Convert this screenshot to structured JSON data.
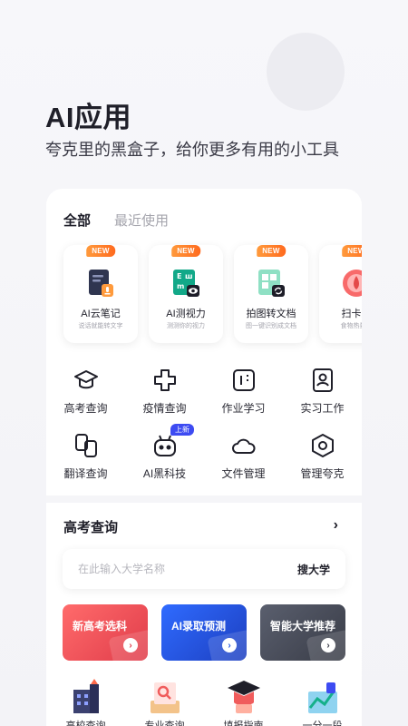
{
  "header": {
    "title": "AI应用",
    "subtitle": "夸克里的黑盒子，给你更多有用的小工具"
  },
  "tabs": [
    {
      "label": "全部",
      "active": true
    },
    {
      "label": "最近使用",
      "active": false
    }
  ],
  "featured": [
    {
      "badge": "NEW",
      "name": "AI云笔记",
      "desc": "说话就能转文字",
      "icon": "note-icon"
    },
    {
      "badge": "NEW",
      "name": "AI测视力",
      "desc": "测测你的视力",
      "icon": "eye-chart-icon"
    },
    {
      "badge": "NEW",
      "name": "拍图转文档",
      "desc": "图一键识别成文档",
      "icon": "scan-doc-icon"
    },
    {
      "badge": "NEW",
      "name": "扫卡路",
      "desc": "食物热量一",
      "icon": "calorie-icon"
    }
  ],
  "grid": [
    {
      "label": "高考查询",
      "icon": "graduation-cap-icon"
    },
    {
      "label": "疫情查询",
      "icon": "medical-cross-icon"
    },
    {
      "label": "作业学习",
      "icon": "homework-icon"
    },
    {
      "label": "实习工作",
      "icon": "badge-person-icon"
    },
    {
      "label": "翻译查询",
      "icon": "translate-icon"
    },
    {
      "label": "AI黑科技",
      "icon": "robot-icon",
      "tag": "上新"
    },
    {
      "label": "文件管理",
      "icon": "cloud-icon"
    },
    {
      "label": "管理夸克",
      "icon": "hexagon-icon"
    }
  ],
  "section": {
    "title": "高考查询",
    "arrow": "›",
    "search_placeholder": "在此输入大学名称",
    "search_button": "搜大学"
  },
  "promos": [
    {
      "label": "新高考选科",
      "color": "#f0545c",
      "go": "›"
    },
    {
      "label": "AI录取预测",
      "color": "#2256e0",
      "go": "›"
    },
    {
      "label": "智能大学推荐",
      "color": "#4a4e5c",
      "go": "›"
    }
  ],
  "bottom": [
    {
      "label": "高校查询",
      "icon": "school-building-icon"
    },
    {
      "label": "专业查询",
      "icon": "major-search-icon"
    },
    {
      "label": "填报指南",
      "icon": "guide-cap-icon"
    },
    {
      "label": "一分一段",
      "icon": "score-chart-icon"
    }
  ]
}
